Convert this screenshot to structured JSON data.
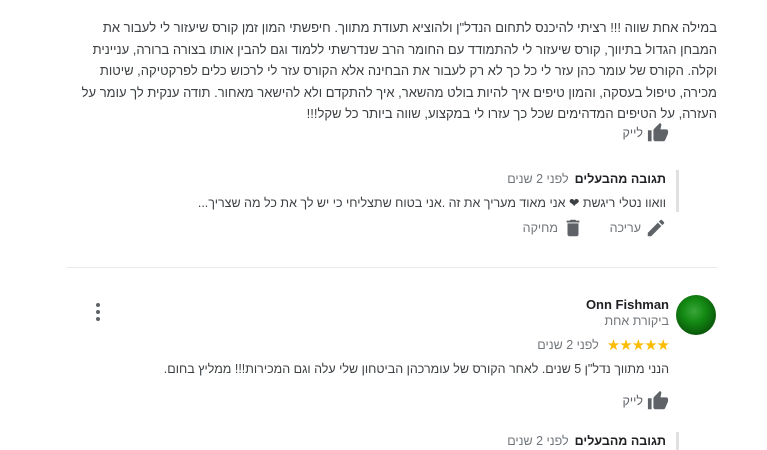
{
  "reviews": [
    {
      "text": "במילה אחת שווה !!! רציתי להיכנס לתחום הנדל\"ן ולהוציא תעודת מתווך. חיפשתי המון זמן קורס שיעזור לי לעבור את המבחן הגדול בתיווך, קורס שיעזור לי להתמודד עם החומר הרב שנדרשתי ללמוד וגם להבין אותו בצורה ברורה, עניינית וקלה. הקורס של עומר כהן עזר לי כל כך לא רק לעבור את הבחינה אלא הקורס עזר לי לרכוש כלים לפרקטיקה, שיטות מכירה, טיפול בעסקה, והמון טיפים איך להיות בולט מהשאר, איך להתקדם ולא להישאר מאחור. תודה ענקית לך עומר על העזרה, על הטיפים המדהימים שכל כך עזרו לי במקצוע, שווה ביותר כל שקל!!!",
      "like_label": "לייק",
      "owner_reply": {
        "title": "תגובה מהבעלים",
        "time": "לפני 2 שנים",
        "text": "וואוו נטלי ריגשת ❤ אני מאוד מעריך את זה .אני בטוח שתצליחי כי יש לך את כל מה שצריך...",
        "edit_label": "עריכה",
        "delete_label": "מחיקה"
      }
    },
    {
      "reviewer_name": "Onn Fishman",
      "reviewer_sub": "ביקורת אחת",
      "stars": "★★★★★",
      "rating": 5,
      "time": "לפני 2 שנים",
      "text": "הנני מתווך נדל\"ן 5 שנים. לאחר הקורס של עומרכהן הביטחון שלי עלה וגם המכירות!!! ממליץ בחום.",
      "like_label": "לייק",
      "owner_reply": {
        "title": "תגובה מהבעלים",
        "time": "לפני 2 שנים"
      }
    }
  ]
}
